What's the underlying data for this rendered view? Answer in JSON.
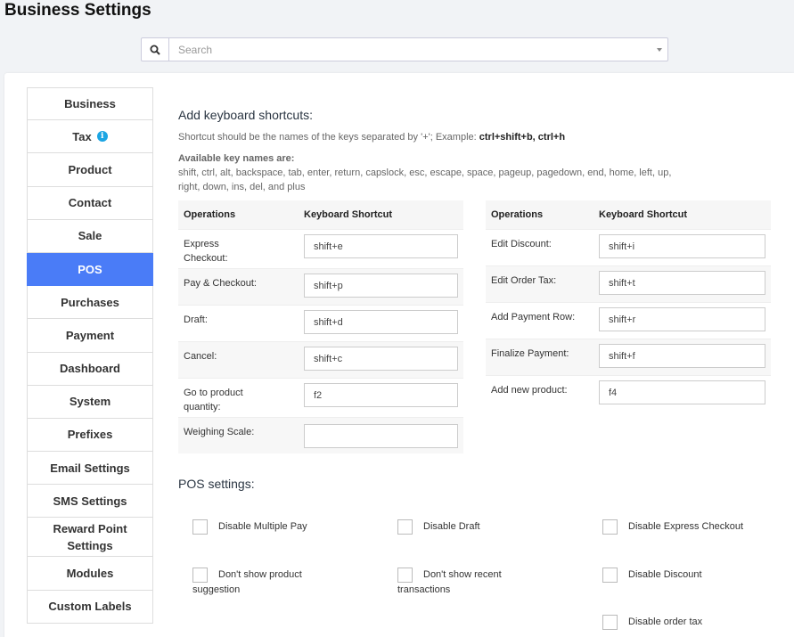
{
  "page_title": "Business Settings",
  "search": {
    "placeholder": "Search"
  },
  "nav": [
    {
      "label": "Business",
      "active": false
    },
    {
      "label": "Tax",
      "active": false
    },
    {
      "label": "Product",
      "active": false
    },
    {
      "label": "Contact",
      "active": false
    },
    {
      "label": "Sale",
      "active": false
    },
    {
      "label": "POS",
      "active": true
    },
    {
      "label": "Purchases",
      "active": false
    },
    {
      "label": "Payment",
      "active": false
    },
    {
      "label": "Dashboard",
      "active": false
    },
    {
      "label": "System",
      "active": false
    },
    {
      "label": "Prefixes",
      "active": false
    },
    {
      "label": "Email Settings",
      "active": false
    },
    {
      "label": "SMS Settings",
      "active": false
    },
    {
      "label": "Reward Point Settings",
      "active": false
    },
    {
      "label": "Modules",
      "active": false
    },
    {
      "label": "Custom Labels",
      "active": false
    }
  ],
  "shortcuts": {
    "title": "Add keyboard shortcuts:",
    "hint_prefix": "Shortcut should be the names of the keys separated by '+'; Example: ",
    "hint_example": "ctrl+shift+b, ctrl+h",
    "keys_title": "Available key names are:",
    "keys_text": "shift, ctrl, alt, backspace, tab, enter, return, capslock, esc, escape, space, pageup, pagedown, end, home, left, up, right, down, ins, del, and plus",
    "col_operations": "Operations",
    "col_shortcut": "Keyboard Shortcut",
    "left_rows": [
      {
        "op": "Express Checkout:",
        "value": "shift+e"
      },
      {
        "op": "Pay & Checkout:",
        "value": "shift+p"
      },
      {
        "op": "Draft:",
        "value": "shift+d"
      },
      {
        "op": "Cancel:",
        "value": "shift+c"
      },
      {
        "op": "Go to product quantity:",
        "value": "f2"
      },
      {
        "op": "Weighing Scale:",
        "value": ""
      }
    ],
    "right_rows": [
      {
        "op": "Edit Discount:",
        "value": "shift+i"
      },
      {
        "op": "Edit Order Tax:",
        "value": "shift+t"
      },
      {
        "op": "Add Payment Row:",
        "value": "shift+r"
      },
      {
        "op": "Finalize Payment:",
        "value": "shift+f"
      },
      {
        "op": "Add new product:",
        "value": "f4"
      }
    ]
  },
  "pos_settings": {
    "title": "POS settings:",
    "options": [
      {
        "label": "Disable Multiple Pay",
        "checked": false
      },
      {
        "label": "Disable Draft",
        "checked": false
      },
      {
        "label": "Disable Express Checkout",
        "checked": false
      },
      {
        "label": "Don't show product",
        "label2": "suggestion",
        "checked": false
      },
      {
        "label": "Don't show recent",
        "label2": "transactions",
        "checked": false
      },
      {
        "label": "Disable Discount",
        "checked": false
      },
      {
        "label": "Disable order tax",
        "checked": false
      }
    ]
  },
  "colors": {
    "accent": "#4a7cf7",
    "info": "#1ba5e3"
  }
}
